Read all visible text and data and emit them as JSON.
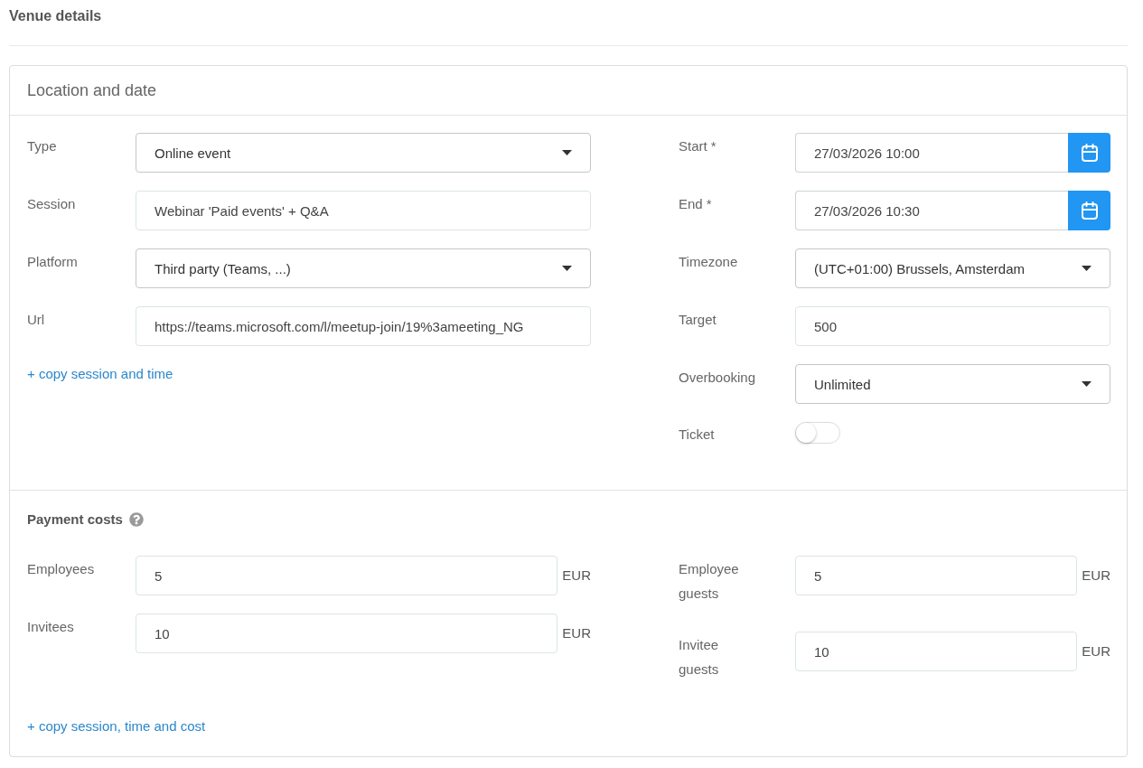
{
  "page": {
    "title": "Venue details"
  },
  "location": {
    "title": "Location and date",
    "left_fields": [
      {
        "kind": "select",
        "label": "Type",
        "value": "Online event"
      },
      {
        "kind": "text",
        "label": "Session",
        "value": "Webinar 'Paid events' + Q&A"
      },
      {
        "kind": "select",
        "label": "Platform",
        "value": "Third party (Teams, ...)"
      },
      {
        "kind": "text",
        "label": "Url",
        "value": "https://teams.microsoft.com/l/meetup-join/19%3ameeting_NG"
      }
    ],
    "link": "+ copy session and time",
    "right_fields": [
      {
        "kind": "datetime",
        "label": "Start *",
        "value": "27/03/2026 10:00"
      },
      {
        "kind": "datetime",
        "label": "End *",
        "value": "27/03/2026 10:30"
      },
      {
        "kind": "select",
        "label": "Timezone",
        "value": "(UTC+01:00) Brussels, Amsterdam"
      },
      {
        "kind": "text",
        "label": "Target",
        "value": "500"
      },
      {
        "kind": "select",
        "label": "Overbooking",
        "value": "Unlimited"
      },
      {
        "kind": "toggle",
        "label": "Ticket",
        "on": false
      }
    ]
  },
  "payment": {
    "title": "Payment costs",
    "left_fields": [
      {
        "label": "Employees",
        "value": "5",
        "unit": "EUR"
      },
      {
        "label": "Invitees",
        "value": "10",
        "unit": "EUR"
      }
    ],
    "right_fields": [
      {
        "label": "Employee guests",
        "value": "5",
        "unit": "EUR"
      },
      {
        "label": "Invitee guests",
        "value": "10",
        "unit": "EUR"
      }
    ],
    "link": "+ copy session, time and cost"
  }
}
